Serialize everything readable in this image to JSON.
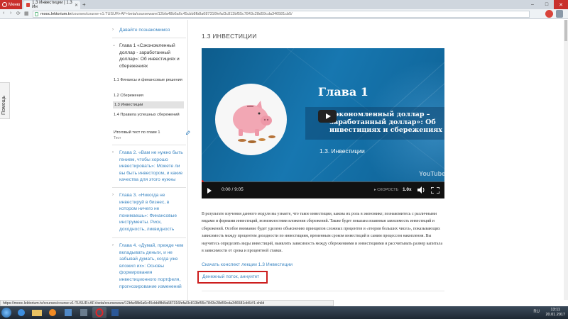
{
  "browser": {
    "menu_label": "Меню",
    "tab_title": "1.3 Инвестиции | 1.3 Ин",
    "new_tab": "+",
    "url_host": "mooc.lektorium.tv",
    "url_rest": "/courses/course-v1:TUSUR+AF+beta/courseware/12bfa48b6a6c45cbb8fb8a687316fefa/3c813bf55c7843c28d59cda346581cb5/",
    "minimize": "–",
    "maximize": "□",
    "close": "✕",
    "back": "‹",
    "forward": "›",
    "reload": "⟳",
    "grid": "▦"
  },
  "help_tab": "Помощь",
  "sidebar": {
    "intro": "Давайте познакомимся",
    "chapter1": "Глава 1 «Сэкономленный доллар - заработанный доллар»: Об инвестициях и сбережениях",
    "sub1": "1.1 Финансы и финансовые решения",
    "sub2": "1.2 Сбережения",
    "sub3": "1.3 Инвестиции",
    "sub4": "1.4 Правила успешных сбережений",
    "test": "Итоговый тест по главе 1",
    "test_sub": "Тест",
    "chapter2": "Глава 2. «Вам не нужно быть гением, чтобы хорошо инвестировать»: Можете ли вы быть инвестором, и какие качества для этого нужны",
    "chapter3": "Глава 3. «Никогда не инвестируй в бизнес, в котором ничего не понимаешь»: Финансовые инструменты. Риск, доходность, ликвидность",
    "chapter4": "Глава 4. «Думай, прежде чем вкладывать деньги, и не забывай думать, когда уже вложил их»: Основы формирования инвестиционного портфеля, прогнозирование изменений"
  },
  "content": {
    "heading": "1.3 ИНВЕСТИЦИИ",
    "video": {
      "chapter": "Глава 1",
      "title": "Сэкономленный доллар – заработанный доллар»: Об инвестициях и сбережениях",
      "part": "1.3. Инвестиции",
      "youtube": "YouTube",
      "time": "0:00 / 9:05",
      "speed_label": "СКОРОСТЬ",
      "speed": "1.0x",
      "progress": 0.0
    },
    "description": "В результате изучения данного модуля вы узнаете, что такое инвестиции, какова их роль в экономике; познакомитесь с различными видами и формами инвестиций, возможностями вложения сбережений. Также будет показана взаимная зависимость инвестиций и сбережений. Особое внимание будет уделено объяснению принципов сложных процентов и «теории больших чисел», показывающих зависимость между процентом доходности по инвестициям, временным сроком инвестиций и самим процессом накопления. Вы научитесь определять виды инвестиций, выявлять зависимость между сбережениями и инвестициями и рассчитывать размер капитала в зависимости от срока и процентной ставки.",
    "download_link": "Скачать конспект лекции 1.3 Инвестиции",
    "next_link": "Денежный поток, аннуитет"
  },
  "status_bar": "https://mooc.lektorium.tv/courses/course-v1:TUSUR+AF+beta/courseware/12bfa48b6a6c45cbb8fb8a687316fefa/3c813bf55c7843c28d59cda346581cb5/#1-child",
  "taskbar": {
    "lang": "RU",
    "time": "13:11",
    "date": "20.01.2017"
  },
  "colors": {
    "accent_link": "#3c86c2",
    "highlight_border": "#cc1e1e",
    "video_bg": "#1777b0",
    "browser_red": "#c9302c"
  }
}
